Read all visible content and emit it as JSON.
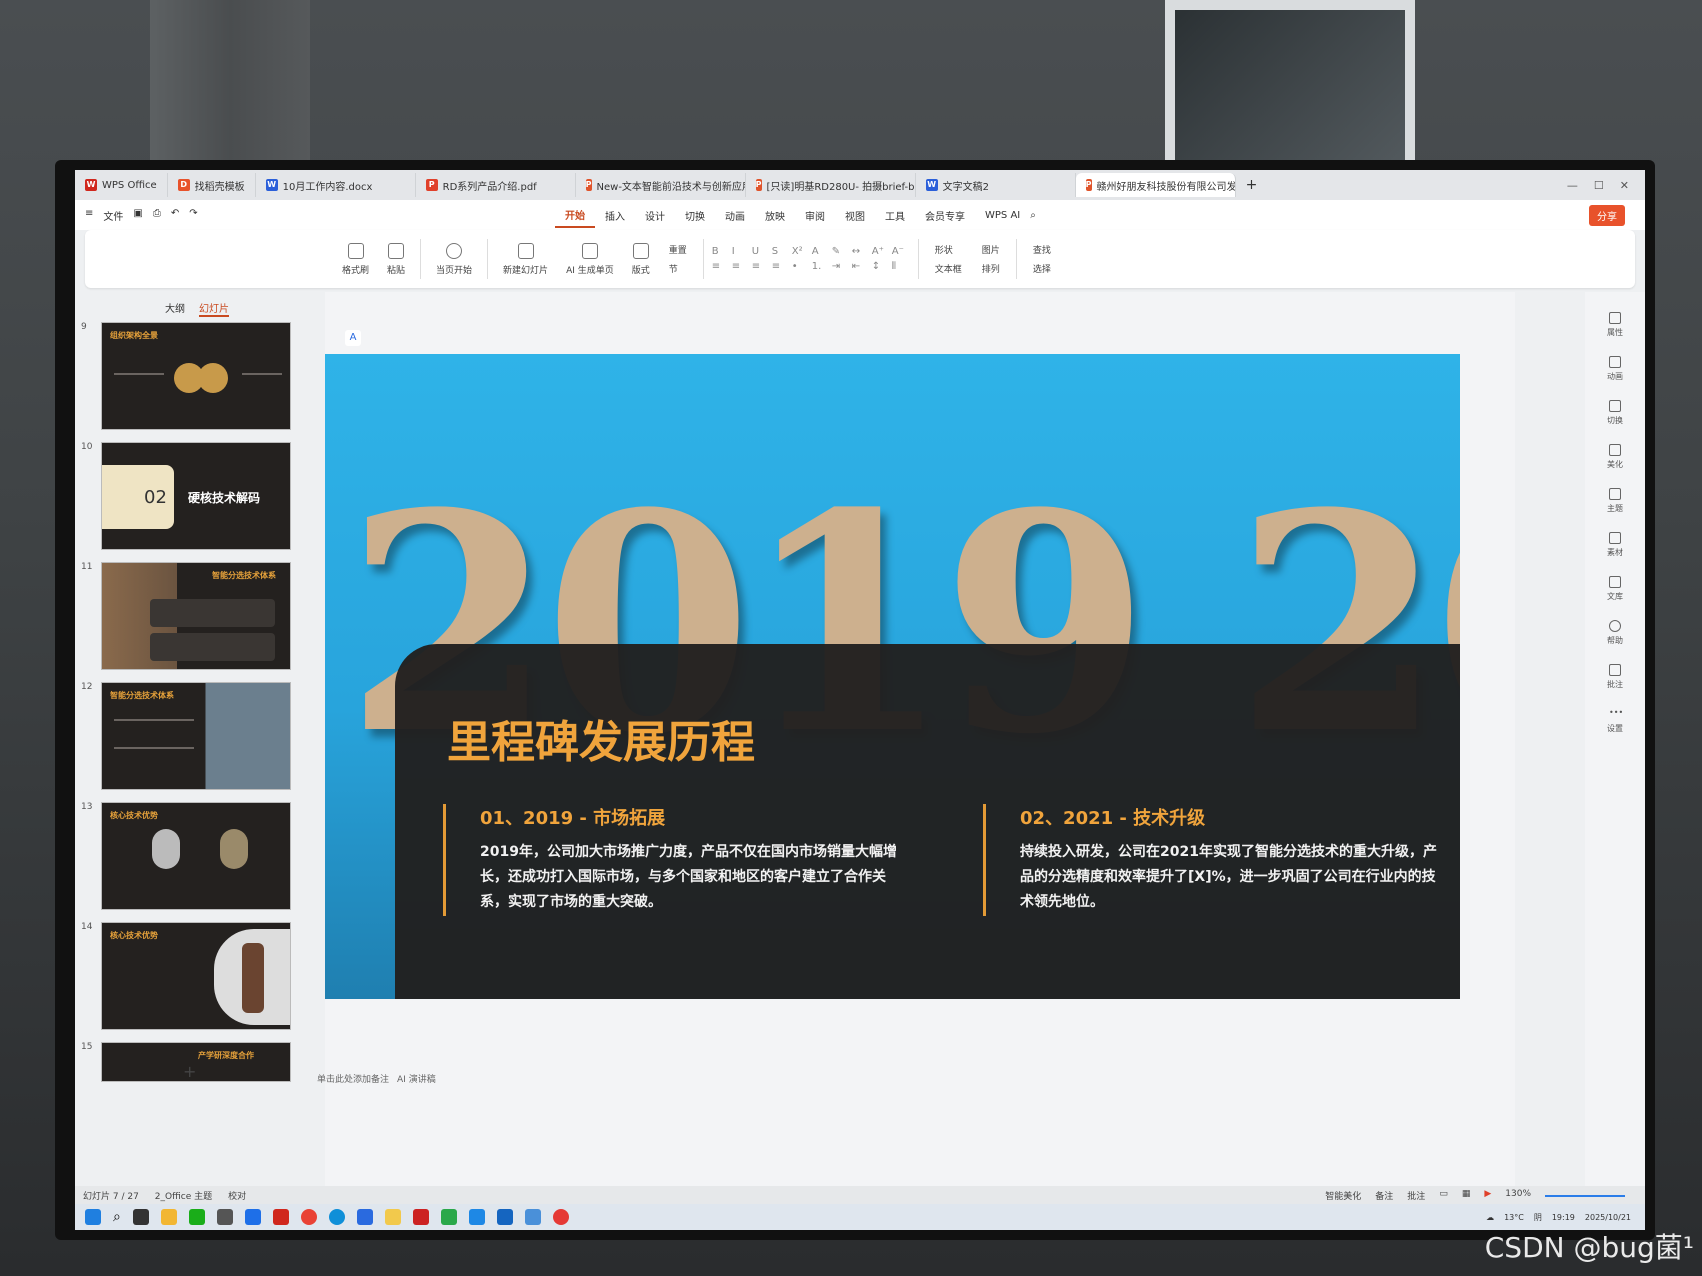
{
  "tabs": [
    {
      "label": "WPS Office",
      "color": "#d0271d",
      "icon": "W"
    },
    {
      "label": "找稻壳模板",
      "color": "#e8522b",
      "icon": "D"
    },
    {
      "label": "10月工作内容.docx",
      "color": "#2b5fd9",
      "icon": "W"
    },
    {
      "label": "RD系列产品介绍.pdf",
      "color": "#e0402a",
      "icon": "P"
    },
    {
      "label": "New-文本智能前沿技术与创新应用...",
      "color": "#e0542b",
      "icon": "P"
    },
    {
      "label": "[只读]明基RD280U- 拍摄brief-bug...",
      "color": "#e0542b",
      "icon": "P"
    },
    {
      "label": "文字文稿2",
      "color": "#2b5fd9",
      "icon": "W"
    },
    {
      "label": "赣州好朋友科技股份有限公司发展...",
      "color": "#e0542b",
      "icon": "P"
    }
  ],
  "file_menu": "文件",
  "menus": [
    "开始",
    "插入",
    "设计",
    "切换",
    "动画",
    "放映",
    "审阅",
    "视图",
    "工具",
    "会员专享",
    "WPS AI"
  ],
  "share_label": "分享",
  "ribbon": {
    "format_painter": "格式刷",
    "paste": "粘贴",
    "start_from_current": "当页开始",
    "new_slide": "新建幻灯片",
    "ai_generate": "AI 生成单页",
    "layout": "版式",
    "reset": "重置",
    "section": "节",
    "shape": "形状",
    "picture": "图片",
    "textbox": "文本框",
    "arrange": "排列",
    "find": "查找",
    "select": "选择"
  },
  "left_panel": {
    "tab_outline": "大纲",
    "tab_slides": "幻灯片",
    "thumbs": [
      {
        "num": "9",
        "title": "组织架构全景"
      },
      {
        "num": "10",
        "title": "硬核技术解码",
        "badge": "02"
      },
      {
        "num": "11",
        "title": "智能分选技术体系"
      },
      {
        "num": "12",
        "title": "智能分选技术体系"
      },
      {
        "num": "13",
        "title": "核心技术优势"
      },
      {
        "num": "14",
        "title": "核心技术优势"
      },
      {
        "num": "15",
        "title": "产学研深度合作"
      }
    ],
    "add": "+"
  },
  "slide": {
    "big_year": "2019 20",
    "title": "里程碑发展历程",
    "col1_heading": "01、2019 - 市场拓展",
    "col1_text": "2019年，公司加大市场推广力度，产品不仅在国内市场销量大幅增长，还成功打入国际市场，与多个国家和地区的客户建立了合作关系，实现了市场的重大突破。",
    "col2_heading": "02、2021 - 技术升级",
    "col2_text": "持续投入研发，公司在2021年实现了智能分选技术的重大升级，产品的分选精度和效率提升了[X]%，进一步巩固了公司在行业内的技术领先地位。"
  },
  "notes_hint": "单击此处添加备注",
  "ai_notes": "AI 演讲稿",
  "right_bar": [
    "属性",
    "动画",
    "切换",
    "美化",
    "主题",
    "素材",
    "文库",
    "帮助",
    "批注",
    "设置"
  ],
  "status": {
    "slide_count": "幻灯片 7 / 27",
    "theme": "2_Office 主题",
    "proof": "校对",
    "smart_beautify": "智能美化",
    "notes": "备注",
    "comments": "批注",
    "zoom": "130%"
  },
  "tray": {
    "temp": "13°C",
    "weather": "阴",
    "time": "19:19",
    "date": "2025/10/21"
  },
  "watermark": "CSDN @bug菌¹"
}
